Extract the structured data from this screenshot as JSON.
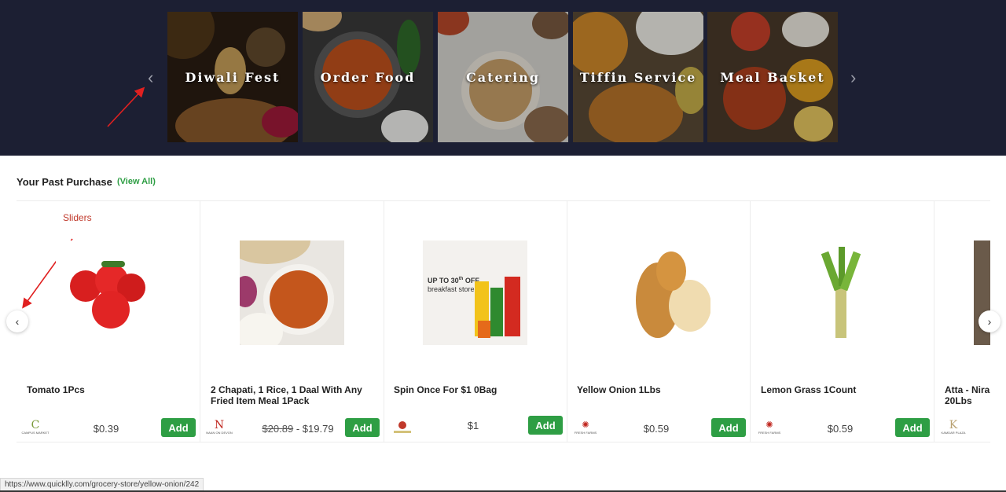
{
  "banner": {
    "categories": [
      {
        "label": "Diwali Fest"
      },
      {
        "label": "Order Food"
      },
      {
        "label": "Catering"
      },
      {
        "label": "Tiffin Service"
      },
      {
        "label": "Meal Basket"
      }
    ],
    "prev_icon": "chevron-left-icon",
    "next_icon": "chevron-right-icon"
  },
  "annotations": {
    "sliders_label": "Sliders",
    "color": "#e02020"
  },
  "past_purchase": {
    "title": "Your Past Purchase",
    "view_all": "(View All)",
    "add_label": "Add",
    "products": [
      {
        "name": "Tomato 1Pcs",
        "store": "CAMPUS MARKET",
        "store_glyph": "C",
        "price": "$0.39",
        "old_price": ""
      },
      {
        "name": "2 Chapati, 1 Rice, 1 Daal With Any Fried Item Meal 1Pack",
        "store": "NAAN ON DEVON",
        "store_glyph": "N",
        "price": "$19.79",
        "old_price": "$20.89"
      },
      {
        "name": "Spin Once For $1 0Bag",
        "store": "",
        "store_glyph": "",
        "price": "$1",
        "old_price": ""
      },
      {
        "name": "Yellow Onion 1Lbs",
        "store": "FRESH FARMS",
        "store_glyph": "",
        "price": "$0.59",
        "old_price": ""
      },
      {
        "name": "Lemon Grass 1Count",
        "store": "FRESH FARMS",
        "store_glyph": "",
        "price": "$0.59",
        "old_price": ""
      },
      {
        "name": "Atta - Nira 20Lbs",
        "store": "KAMDAR PLAZA",
        "store_glyph": "K",
        "price": "",
        "old_price": ""
      }
    ],
    "promo_text": {
      "line1": "UP TO 30",
      "sup": "th",
      "line1_end": " OFF",
      "line2": "breakfast store"
    }
  },
  "status_bar": {
    "url": "https://www.quicklly.com/grocery-store/yellow-onion/242"
  },
  "colors": {
    "banner_bg": "#1c1f33",
    "accent_green": "#2e9e44"
  }
}
